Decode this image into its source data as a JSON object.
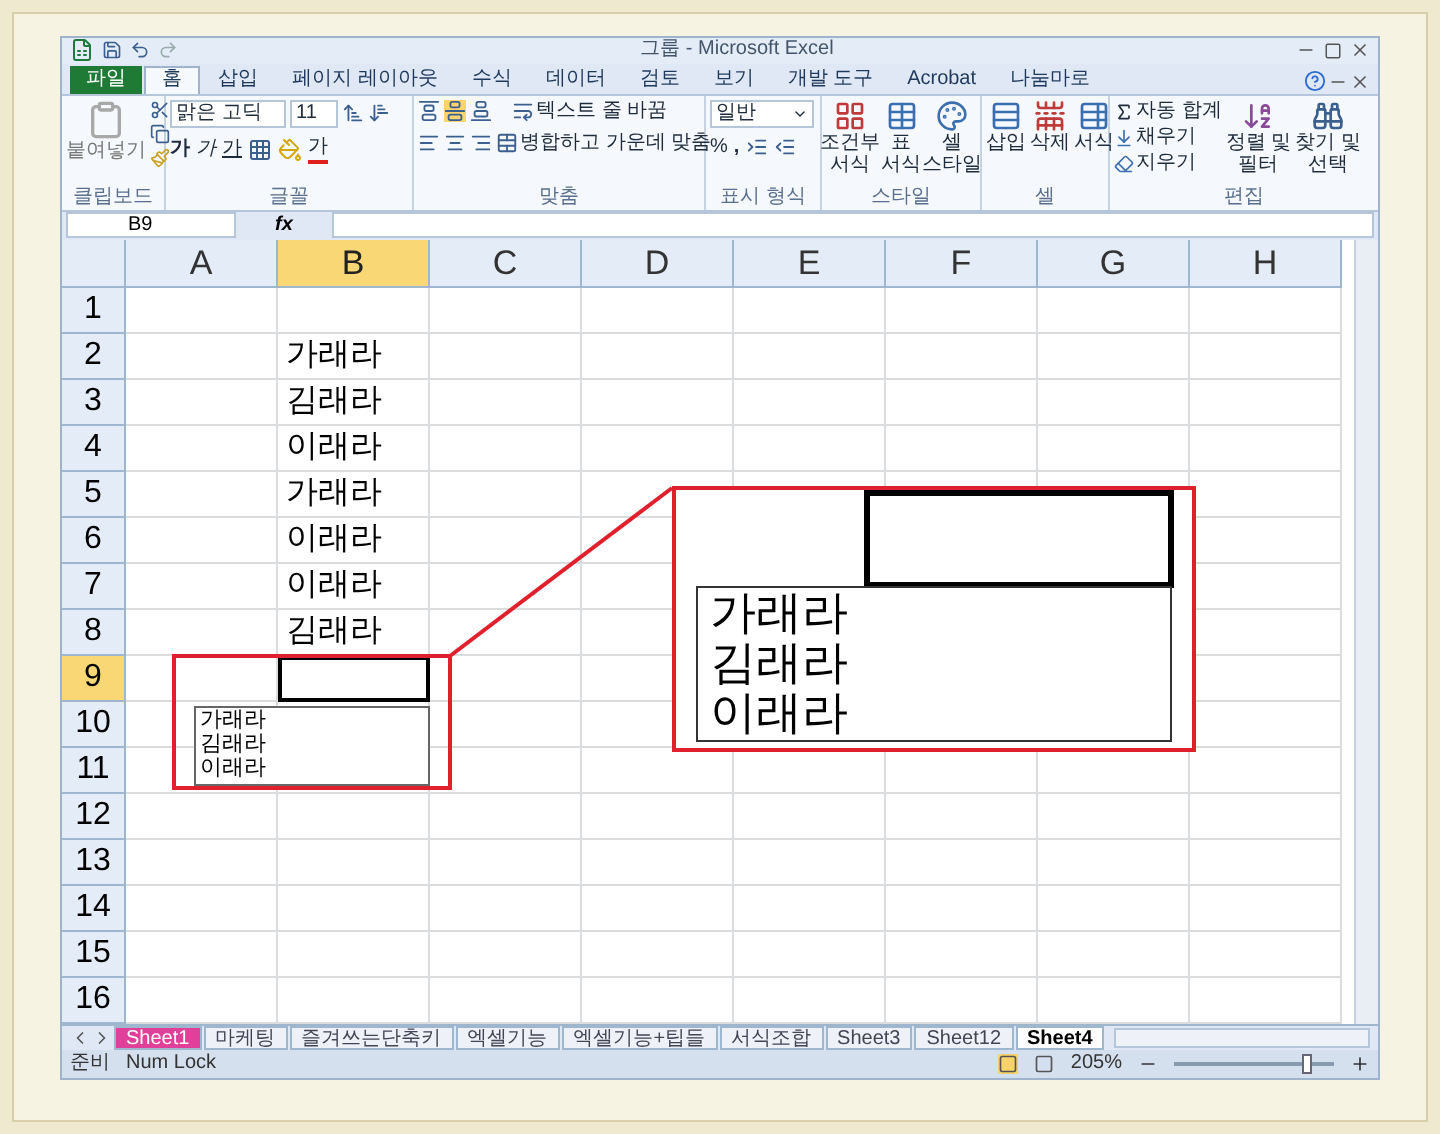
{
  "window": {
    "title": "그룹 - Microsoft Excel"
  },
  "tabs": [
    {
      "label": "파일",
      "kind": "file",
      "selected": false
    },
    {
      "label": "홈",
      "kind": "tab",
      "selected": true
    },
    {
      "label": "삽입",
      "kind": "tab",
      "selected": false
    },
    {
      "label": "페이지 레이아웃",
      "kind": "tab",
      "selected": false
    },
    {
      "label": "수식",
      "kind": "tab",
      "selected": false
    },
    {
      "label": "데이터",
      "kind": "tab",
      "selected": false
    },
    {
      "label": "검토",
      "kind": "tab",
      "selected": false
    },
    {
      "label": "보기",
      "kind": "tab",
      "selected": false
    },
    {
      "label": "개발 도구",
      "kind": "tab",
      "selected": false
    },
    {
      "label": "Acrobat",
      "kind": "tab",
      "selected": false
    },
    {
      "label": "나눔마로",
      "kind": "tab",
      "selected": false
    }
  ],
  "ribbon": {
    "clipboard": {
      "label": "클립보드",
      "paste": "붙여넣기"
    },
    "font": {
      "label": "글꼴",
      "font_name": "맑은 고딕",
      "font_size": "11",
      "bold": "가",
      "italic": "가",
      "underline": "가",
      "font_color": "가"
    },
    "alignment": {
      "label": "맞춤",
      "wrap": "텍스트 줄 바꿈",
      "merge": "병합하고 가운데 맞춤"
    },
    "number": {
      "label": "표시 형식",
      "format": "일반",
      "percent": "%",
      "comma": ","
    },
    "styles": {
      "label": "스타일",
      "buttons": [
        [
          "조건부",
          "서식"
        ],
        [
          "표",
          "서식"
        ],
        [
          "셀",
          "스타일"
        ]
      ]
    },
    "cells": {
      "label": "셀",
      "buttons": [
        "삽입",
        "삭제",
        "서식"
      ]
    },
    "editing": {
      "label": "편집",
      "autosum": "자동 합계",
      "fill": "채우기",
      "clear": "지우기",
      "sort": [
        "정렬 및",
        "필터"
      ],
      "find": [
        "찾기 및",
        "선택"
      ]
    }
  },
  "formula_bar": {
    "name_box": "B9",
    "fx": "fx"
  },
  "columns": [
    {
      "label": "A",
      "selected": false
    },
    {
      "label": "B",
      "selected": true
    },
    {
      "label": "C",
      "selected": false
    },
    {
      "label": "D",
      "selected": false
    },
    {
      "label": "E",
      "selected": false
    },
    {
      "label": "F",
      "selected": false
    },
    {
      "label": "G",
      "selected": false
    },
    {
      "label": "H",
      "selected": false
    }
  ],
  "rows": [
    {
      "label": "1",
      "selected": false
    },
    {
      "label": "2",
      "selected": false,
      "b": "가래라"
    },
    {
      "label": "3",
      "selected": false,
      "b": "김래라"
    },
    {
      "label": "4",
      "selected": false,
      "b": "이래라"
    },
    {
      "label": "5",
      "selected": false,
      "b": "가래라"
    },
    {
      "label": "6",
      "selected": false,
      "b": "이래라"
    },
    {
      "label": "7",
      "selected": false,
      "b": "이래라"
    },
    {
      "label": "8",
      "selected": false,
      "b": "김래라"
    },
    {
      "label": "9",
      "selected": true
    },
    {
      "label": "10",
      "selected": false
    },
    {
      "label": "11",
      "selected": false
    },
    {
      "label": "12",
      "selected": false
    },
    {
      "label": "13",
      "selected": false
    },
    {
      "label": "14",
      "selected": false
    },
    {
      "label": "15",
      "selected": false
    },
    {
      "label": "16",
      "selected": false
    }
  ],
  "dropdown_list": {
    "items": [
      "가래라",
      "김래라",
      "이래라"
    ]
  },
  "zoom_callout": {
    "items": [
      "가래라",
      "김래라",
      "이래라"
    ]
  },
  "sheet_tabs": [
    {
      "label": "Sheet1",
      "selected": false,
      "color": "#e0409a"
    },
    {
      "label": "마케팅",
      "selected": false
    },
    {
      "label": "즐겨쓰는단축키",
      "selected": false
    },
    {
      "label": "엑셀기능",
      "selected": false
    },
    {
      "label": "엑셀기능+팁들",
      "selected": false
    },
    {
      "label": "서식조합",
      "selected": false
    },
    {
      "label": "Sheet3",
      "selected": false
    },
    {
      "label": "Sheet12",
      "selected": false
    },
    {
      "label": "Sheet4",
      "selected": true
    }
  ],
  "status_bar": {
    "mode": "준비",
    "num_lock": "Num Lock",
    "zoom": "205%",
    "zoom_slider": {
      "level": 0.82
    }
  }
}
